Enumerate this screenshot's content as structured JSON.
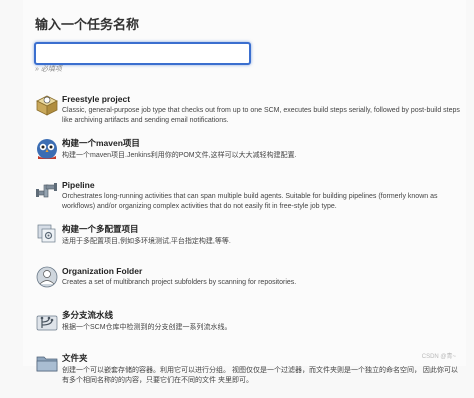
{
  "header": {
    "title": "输入一个任务名称"
  },
  "name_field": {
    "value": "",
    "hint": "» 必填项"
  },
  "items": [
    {
      "label": "Freestyle project",
      "desc": "Classic, general-purpose job type that checks out from up to one SCM, executes build steps serially, followed by post-build steps like archiving artifacts and sending email notifications."
    },
    {
      "label": "构建一个maven项目",
      "desc": "构建一个maven项目.Jenkins利用你的POM文件,这样可以大大减轻构建配置."
    },
    {
      "label": "Pipeline",
      "desc": "Orchestrates long-running activities that can span multiple build agents. Suitable for building pipelines (formerly known as workflows) and/or organizing complex activities that do not easily fit in free-style job type."
    },
    {
      "label": "构建一个多配置项目",
      "desc": "适用于多配置项目,例如多环境测试,平台指定构建,等等."
    },
    {
      "label": "Organization Folder",
      "desc": "Creates a set of multibranch project subfolders by scanning for repositories."
    },
    {
      "label": "多分支流水线",
      "desc": "根据一个SCM仓库中检测到的分支创建一系列流水线。"
    },
    {
      "label": "文件夹",
      "desc": "创建一个可以嵌套存储的容器。利用它可以进行分组。 视图仅仅是一个过滤器，而文件夹则是一个独立的命名空间， 因此你可以有多个相同名称的的内容，只要它们在不同的文件 夹里即可。"
    }
  ],
  "watermark": "CSDN @青~",
  "icons": [
    "freestyle-box-icon",
    "maven-owl-icon",
    "pipeline-pipes-icon",
    "multi-config-icon",
    "organization-folder-icon",
    "multibranch-icon",
    "folder-icon"
  ]
}
